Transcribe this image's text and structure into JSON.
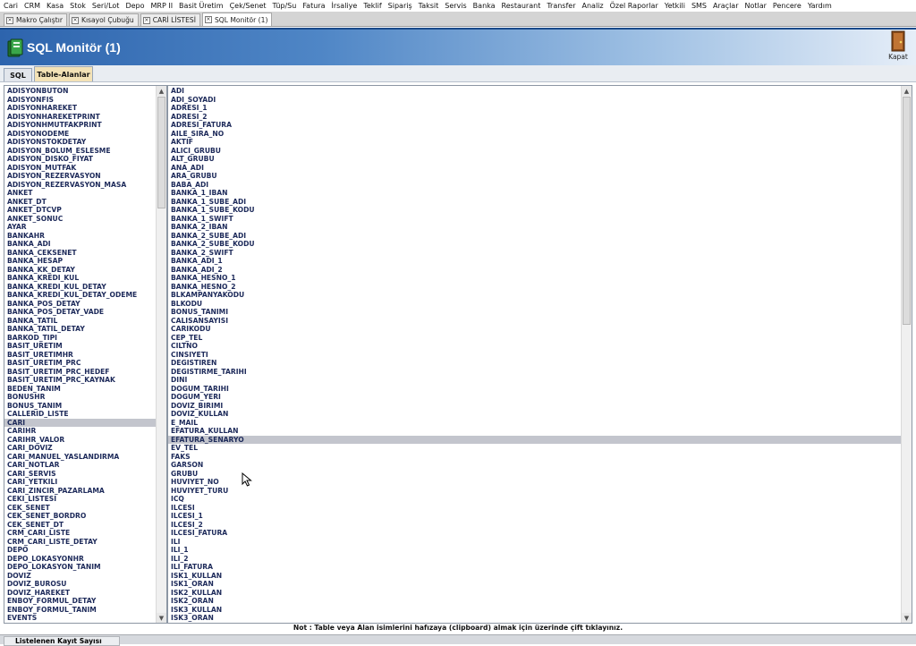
{
  "menu": [
    "Cari",
    "CRM",
    "Kasa",
    "Stok",
    "Seri/Lot",
    "Depo",
    "MRP II",
    "Basit Üretim",
    "Çek/Senet",
    "Tüp/Su",
    "Fatura",
    "İrsaliye",
    "Teklif",
    "Sipariş",
    "Taksit",
    "Servis",
    "Banka",
    "Restaurant",
    "Transfer",
    "Analiz",
    "Özel Raporlar",
    "Yetkili",
    "SMS",
    "Araçlar",
    "Notlar",
    "Pencere",
    "Yardım"
  ],
  "doc_tabs": [
    {
      "label": "Makro Çalıştır",
      "active": false
    },
    {
      "label": "Kısayol Çubuğu",
      "active": false
    },
    {
      "label": "CARİ LİSTESİ",
      "active": false
    },
    {
      "label": "SQL Monitör (1)",
      "active": true
    }
  ],
  "header": {
    "title": "SQL Monitör (1)",
    "close_label": "Kapat"
  },
  "subtabs": [
    {
      "label": "SQL",
      "active": false
    },
    {
      "label": "Table-Alanlar",
      "active": true
    }
  ],
  "tables": {
    "selected": "CARI",
    "items": [
      "ADISYONBUTON",
      "ADISYONFIS",
      "ADISYONHAREKET",
      "ADISYONHAREKETPRINT",
      "ADISYONHMUTFAKPRINT",
      "ADISYONODEME",
      "ADISYONSTOKDETAY",
      "ADISYON_BOLUM_ESLESME",
      "ADISYON_DISKO_FIYAT",
      "ADISYON_MUTFAK",
      "ADISYON_REZERVASYON",
      "ADISYON_REZERVASYON_MASA",
      "ANKET",
      "ANKET_DT",
      "ANKET_DTCVP",
      "ANKET_SONUC",
      "AYAR",
      "BANKAHR",
      "BANKA_ADI",
      "BANKA_CEKSENET",
      "BANKA_HESAP",
      "BANKA_KK_DETAY",
      "BANKA_KREDI_KUL",
      "BANKA_KREDI_KUL_DETAY",
      "BANKA_KREDI_KUL_DETAY_ODEME",
      "BANKA_POS_DETAY",
      "BANKA_POS_DETAY_VADE",
      "BANKA_TATIL",
      "BANKA_TATIL_DETAY",
      "BARKOD_TIPI",
      "BASIT_URETIM",
      "BASIT_URETIMHR",
      "BASIT_URETIM_PRC",
      "BASIT_URETIM_PRC_HEDEF",
      "BASIT_URETIM_PRC_KAYNAK",
      "BEDEN_TANIM",
      "BONUSHR",
      "BONUS_TANIM",
      "CALLERID_LISTE",
      "CARI",
      "CARIHR",
      "CARIHR_VALOR",
      "CARI_DOVIZ",
      "CARI_MANUEL_YASLANDIRMA",
      "CARI_NOTLAR",
      "CARI_SERVIS",
      "CARI_YETKILI",
      "CARI_ZINCIR_PAZARLAMA",
      "CEKI_LISTESI",
      "CEK_SENET",
      "CEK_SENET_BORDRO",
      "CEK_SENET_DT",
      "CRM_CARI_LISTE",
      "CRM_CARI_LISTE_DETAY",
      "DEPO",
      "DEPO_LOKASYONHR",
      "DEPO_LOKASYON_TANIM",
      "DOVIZ",
      "DOVIZ_BUROSU",
      "DOVIZ_HAREKET",
      "ENBOY_FORMUL_DETAY",
      "ENBOY_FORMUL_TANIM",
      "EVENTS"
    ]
  },
  "fields": {
    "selected": "EFATURA_SENARYO",
    "items": [
      "ADI",
      "ADI_SOYADI",
      "ADRESI_1",
      "ADRESI_2",
      "ADRESI_FATURA",
      "AILE_SIRA_NO",
      "AKTIF",
      "ALICI_GRUBU",
      "ALT_GRUBU",
      "ANA_ADI",
      "ARA_GRUBU",
      "BABA_ADI",
      "BANKA_1_IBAN",
      "BANKA_1_SUBE_ADI",
      "BANKA_1_SUBE_KODU",
      "BANKA_1_SWIFT",
      "BANKA_2_IBAN",
      "BANKA_2_SUBE_ADI",
      "BANKA_2_SUBE_KODU",
      "BANKA_2_SWIFT",
      "BANKA_ADI_1",
      "BANKA_ADI_2",
      "BANKA_HESNO_1",
      "BANKA_HESNO_2",
      "BLKAMPANYAKODU",
      "BLKODU",
      "BONUS_TANIMI",
      "CALISANSAYISI",
      "CARIKODU",
      "CEP_TEL",
      "CILTNO",
      "CINSIYETI",
      "DEGISTIREN",
      "DEGISTIRME_TARIHI",
      "DINI",
      "DOGUM_TARIHI",
      "DOGUM_YERI",
      "DOVIZ_BIRIMI",
      "DOVIZ_KULLAN",
      "E_MAIL",
      "EFATURA_KULLAN",
      "EFATURA_SENARYO",
      "EV_TEL",
      "FAKS",
      "GARSON",
      "GRUBU",
      "HUVIYET_NO",
      "HUVIYET_TURU",
      "ICQ",
      "ILCESI",
      "ILCESI_1",
      "ILCESI_2",
      "ILCESI_FATURA",
      "ILI",
      "ILI_1",
      "ILI_2",
      "ILI_FATURA",
      "ISK1_KULLAN",
      "ISK1_ORAN",
      "ISK2_KULLAN",
      "ISK2_ORAN",
      "ISK3_KULLAN",
      "ISK3_ORAN"
    ]
  },
  "note": "Not : Table veya Alan isimlerini hafızaya (clipboard) almak için üzerinde çift tıklayınız.",
  "status": {
    "label": "Listelenen Kayıt Sayısı"
  }
}
